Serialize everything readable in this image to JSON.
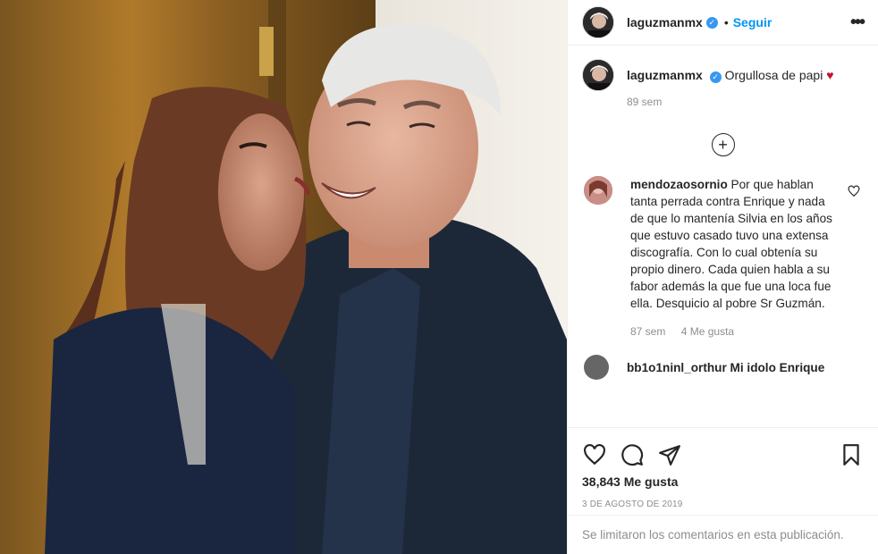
{
  "post": {
    "username": "laguzmanmx",
    "follow_label": "Seguir",
    "dot": "•",
    "verified_glyph": "✓",
    "more_label": "•••"
  },
  "caption": {
    "username": "laguzmanmx",
    "text": "Orgullosa de papi",
    "heart": "♥",
    "time": "89 sem"
  },
  "load_more_glyph": "+",
  "comments": [
    {
      "username": "mendozaosornio",
      "text": "Por que hablan tanta perrada contra Enrique y nada de que lo mantenía Silvia en los años que estuvo casado tuvo una extensa discografía. Con lo cual obtenía su propio dinero. Cada quien habla a su fabor además la que fue una loca fue ella. Desquicio al pobre Sr Guzmán.",
      "time": "87 sem",
      "likes": "4 Me gusta"
    }
  ],
  "partial_comment": "bb1o1ninl_orthur Mi idolo Enrique",
  "actions": {
    "likes_count": "38,843 Me gusta",
    "date": "3 DE AGOSTO DE 2019"
  },
  "comments_disabled": "Se limitaron los comentarios en esta publicación.",
  "colors": {
    "accent": "#0095f6",
    "verified": "#3897f0",
    "heart": "#c8102e",
    "muted": "#8e8e8e"
  },
  "icons": [
    "more-options-icon",
    "verified-badge-icon",
    "plus-circle-icon",
    "heart-outline-icon",
    "comment-icon",
    "share-icon",
    "bookmark-icon"
  ]
}
